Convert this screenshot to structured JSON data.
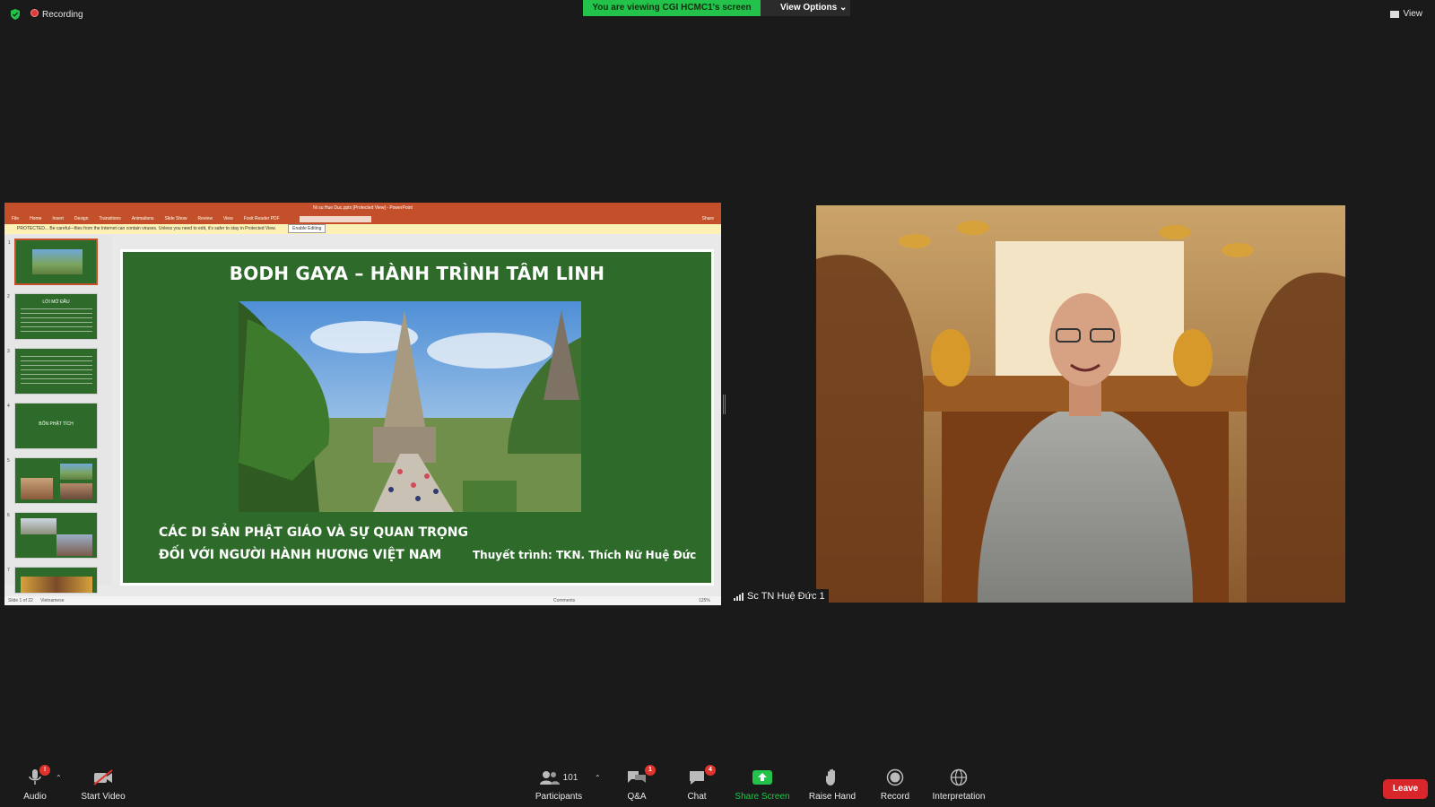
{
  "top_bar": {
    "recording_label": "Recording",
    "viewing_banner": "You are viewing CGI HCMC1's screen",
    "view_options_label": "View Options ⌄",
    "view_label": "View"
  },
  "shared_screen": {
    "app_title": "Ni su Hue Duc.pptx [Protected View] - PowerPoint",
    "ribbon_tabs": [
      "File",
      "Home",
      "Insert",
      "Design",
      "Transitions",
      "Animations",
      "Slide Show",
      "Review",
      "View",
      "Foxit Reader PDF"
    ],
    "share_label": "Share",
    "protected_message": "PROTECTED... Be careful—files from the Internet can contain viruses. Unless you need to edit, it's safer to stay in Protected View.",
    "enable_editing_label": "Enable Editing",
    "thumbnails": [
      {
        "num": "1",
        "text": ""
      },
      {
        "num": "2",
        "text": "LỜI MỞ ĐẦU"
      },
      {
        "num": "3",
        "text": ""
      },
      {
        "num": "4",
        "text": "BỐN PHẬT TÍCH"
      },
      {
        "num": "5",
        "text": ""
      },
      {
        "num": "6",
        "text": ""
      },
      {
        "num": "7",
        "text": ""
      }
    ],
    "slide": {
      "title": "BODH GAYA – HÀNH TRÌNH TÂM LINH",
      "subtitle_line1": "CÁC DI SẢN PHẬT GIÁO VÀ SỰ QUAN TRỌNG",
      "subtitle_line2": "ĐỐI VỚI NGƯỜI HÀNH HƯƠNG VIỆT NAM",
      "author": "Thuyết trình: TKN. Thích Nữ Huệ Đức",
      "background_color": "#2e6b2a"
    },
    "status_bar": {
      "slide_count": "Slide 1 of 22",
      "language": "Vietnamese",
      "comments_label": "Comments",
      "zoom": "125%"
    }
  },
  "video": {
    "participant_name": "Sc TN Huệ Đức 1"
  },
  "toolbar": {
    "audio_label": "Audio",
    "audio_badge": "!",
    "start_video_label": "Start Video",
    "participants_label": "Participants",
    "participants_count": "101",
    "qa_label": "Q&A",
    "qa_badge": "1",
    "chat_label": "Chat",
    "chat_badge": "4",
    "share_screen_label": "Share Screen",
    "raise_hand_label": "Raise Hand",
    "record_label": "Record",
    "interpretation_label": "Interpretation",
    "leave_label": "Leave",
    "share_color": "#23c24b",
    "leave_color": "#d9262b"
  }
}
